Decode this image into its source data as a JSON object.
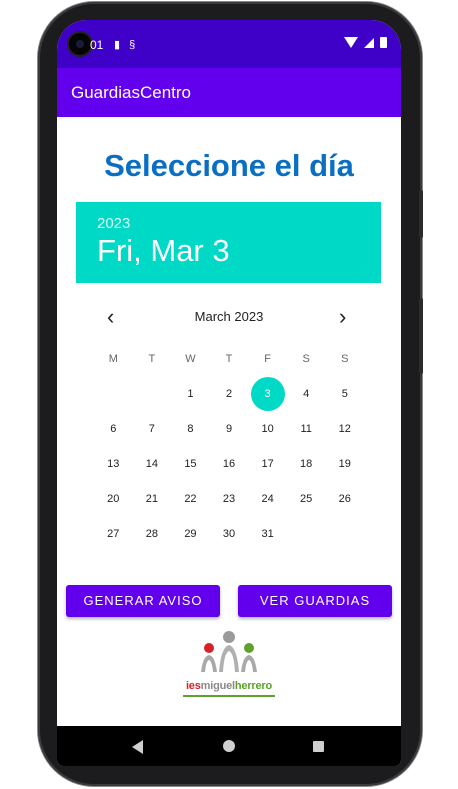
{
  "status_bar": {
    "time": "01"
  },
  "app_bar": {
    "title": "GuardiasCentro"
  },
  "heading": "Seleccione el día",
  "date_picker": {
    "year": "2023",
    "selected_date": "Fri, Mar 3",
    "month_label": "March 2023",
    "prev_icon": "‹",
    "next_icon": "›",
    "weekdays": [
      "M",
      "T",
      "W",
      "T",
      "F",
      "S",
      "S"
    ],
    "weeks": [
      [
        "",
        "",
        "1",
        "2",
        "3",
        "4",
        "5"
      ],
      [
        "6",
        "7",
        "8",
        "9",
        "10",
        "11",
        "12"
      ],
      [
        "13",
        "14",
        "15",
        "16",
        "17",
        "18",
        "19"
      ],
      [
        "20",
        "21",
        "22",
        "23",
        "24",
        "25",
        "26"
      ],
      [
        "27",
        "28",
        "29",
        "30",
        "31",
        "",
        ""
      ]
    ],
    "selected_day": "3"
  },
  "buttons": {
    "generar_aviso": "GENERAR AVISO",
    "ver_guardias": "VER GUARDIAS"
  },
  "logo": {
    "text_part1": "ies",
    "text_part2": "miguel",
    "text_part3": "herrero"
  },
  "colors": {
    "status_bar": "#3f00c8",
    "app_bar": "#6200ee",
    "heading": "#0a6fc2",
    "accent": "#00d9c5",
    "button": "#6200ee"
  },
  "icons": {
    "status": [
      "sd-card-icon",
      "sync-icon",
      "wifi-icon",
      "signal-icon",
      "battery-icon"
    ],
    "nav": [
      "back-icon",
      "home-icon",
      "recents-icon"
    ]
  }
}
